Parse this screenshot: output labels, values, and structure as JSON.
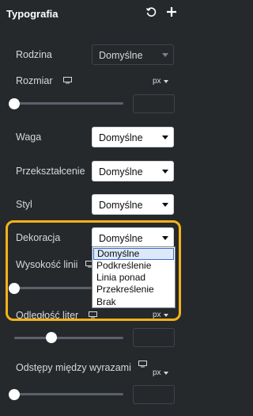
{
  "header": {
    "title": "Typografia",
    "reset_icon": "reset-icon",
    "add_icon": "plus-icon"
  },
  "rodzina": {
    "label": "Rodzina",
    "value": "Domyślne"
  },
  "rozmiar": {
    "label": "Rozmiar",
    "unit": "px",
    "value": ""
  },
  "waga": {
    "label": "Waga",
    "value": "Domyślne"
  },
  "przeksztalcenie": {
    "label": "Przekształcenie",
    "value": "Domyślne"
  },
  "styl": {
    "label": "Styl",
    "value": "Domyślne"
  },
  "dekoracja": {
    "label": "Dekoracja",
    "value": "Domyślne",
    "options": [
      "Domyślne",
      "Podkreślenie",
      "Linia ponad",
      "Przekreślenie",
      "Brak"
    ]
  },
  "wysokosc_linii": {
    "label": "Wysokość linii"
  },
  "odleglosc_liter": {
    "label": "Odległość liter",
    "unit": "px",
    "value": ""
  },
  "odstepy_wyrazy": {
    "label": "Odstępy między wyrazami",
    "unit": "px",
    "value": ""
  },
  "colors": {
    "highlight": "#f5b219",
    "background": "#26292c",
    "selected_option": "#dde9f8"
  }
}
